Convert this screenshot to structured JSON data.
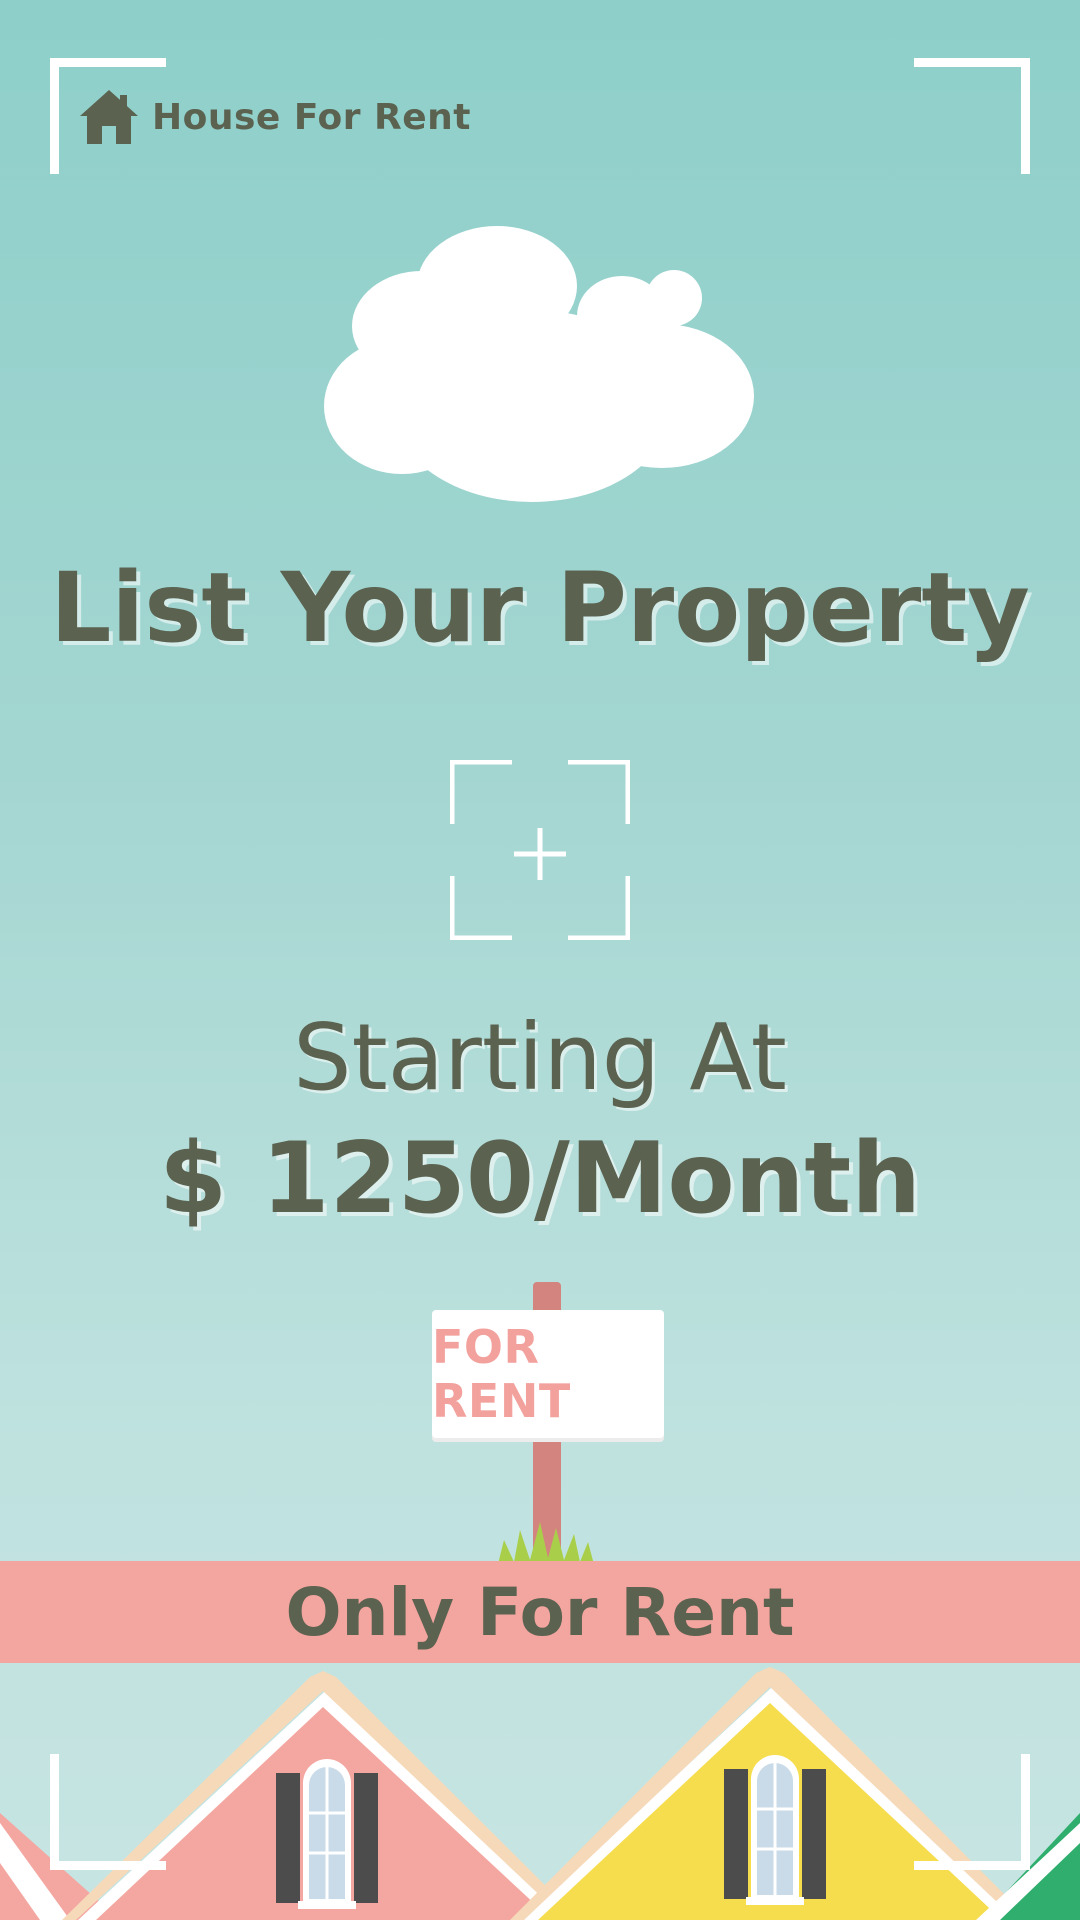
{
  "brand": {
    "icon": "house-icon",
    "name": "House For Rent"
  },
  "headline": "List Your Property",
  "upload": {
    "icon": "add-photo-icon"
  },
  "pricing": {
    "line1": "Starting At",
    "line2": "$ 1250/Month"
  },
  "sign": {
    "text": "FOR RENT"
  },
  "banner": {
    "text": "Only For Rent"
  },
  "colors": {
    "background_top": "#8ecfca",
    "background_bottom": "#c6e4e2",
    "text": "#5b6250",
    "accent": "#f3a59f",
    "sign_text": "#f2a19d"
  }
}
